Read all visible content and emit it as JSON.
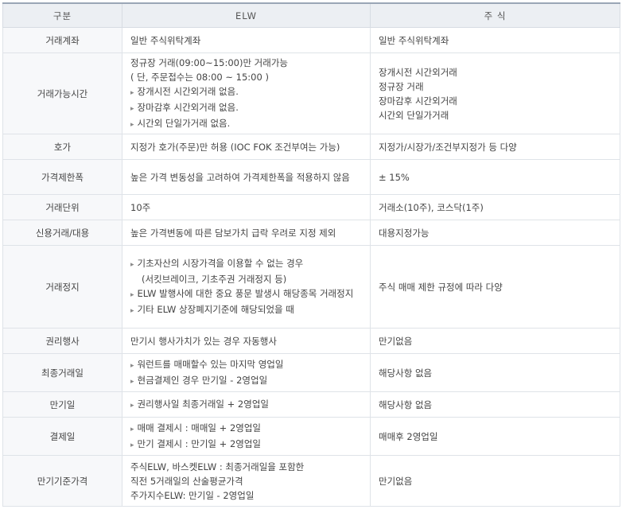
{
  "headers": [
    "구분",
    "ELW",
    "주 식"
  ],
  "rows": [
    {
      "label": "거래계좌",
      "elw": [
        "일반 주식위탁계좌"
      ],
      "stock": [
        "일반 주식위탁계좌"
      ]
    },
    {
      "label": "거래가능시간",
      "elw": [
        "정규장 거래(09:00~15:00)만 거래가능",
        "( 단, 주문접수는 08:00 ~ 15:00 )",
        "장개시전 시간외거래 없음.",
        "장마감후 시간외거래 없음.",
        "시간외 단일가거래 없음."
      ],
      "stock": [
        "장개시전 시간외거래",
        "정규장 거래",
        "장마감후 시간외거래",
        "시간외 단일가거래"
      ]
    },
    {
      "label": "호가",
      "elw": [
        "지정가 호가(주문)만 허용 (IOC FOK 조건부여는 가능)"
      ],
      "stock": [
        "지정가/시장가/조건부지정가 등 다양"
      ]
    },
    {
      "label": "가격제한폭",
      "elw": [
        "높은 가격 변동성을 고려하여 가격제한폭을 적용하지 않음"
      ],
      "stock": [
        "± 15%"
      ]
    },
    {
      "label": "거래단위",
      "elw": [
        "10주"
      ],
      "stock": [
        "거래소(10주), 코스닥(1주)"
      ]
    },
    {
      "label": "신용거래/대용",
      "elw": [
        "높은 가격변동에 따른 담보가치 급락 우려로 지정 제외"
      ],
      "stock": [
        "대용지정가능"
      ]
    },
    {
      "label": "거래정지",
      "elw": [
        "기초자산의 시장가격을 이용할 수 없는 경우",
        "(서킷브레이크, 기초주권 거래정지 등)",
        "ELW 발행사에 대한 중요 풍문 발생시 해당종목 거래정지",
        "기타 ELW 상장폐지기준에 해당되었을 때"
      ],
      "stock": [
        "주식 매매 제한 규정에 따라 다양"
      ]
    },
    {
      "label": "권리행사",
      "elw": [
        "만기시 행사가치가 있는 경우 자동행사"
      ],
      "stock": [
        "만기없음"
      ]
    },
    {
      "label": "최종거래일",
      "elw": [
        "워런트를 매매할수 있는 마지막 영업일",
        "현금결제인 경우 만기일 - 2영업일"
      ],
      "stock": [
        "해당사항 없음"
      ]
    },
    {
      "label": "만기일",
      "elw": [
        "권리행사일 최종거래일 + 2영업일"
      ],
      "stock": [
        "해당사항 없음"
      ]
    },
    {
      "label": "결제일",
      "elw": [
        "매매 결제시 : 매매일 + 2영업일",
        "만기 결제시 : 만기일 + 2영업일"
      ],
      "stock": [
        "매매후 2영업일"
      ]
    },
    {
      "label": "만기기준가격",
      "elw": [
        "주식ELW, 바스켓ELW : 최종거래일을 포함한",
        "직전 5거래일의 산술평균가격",
        "주가지수ELW: 만기일 - 2영업일"
      ],
      "stock": [
        "만기없음"
      ]
    }
  ]
}
